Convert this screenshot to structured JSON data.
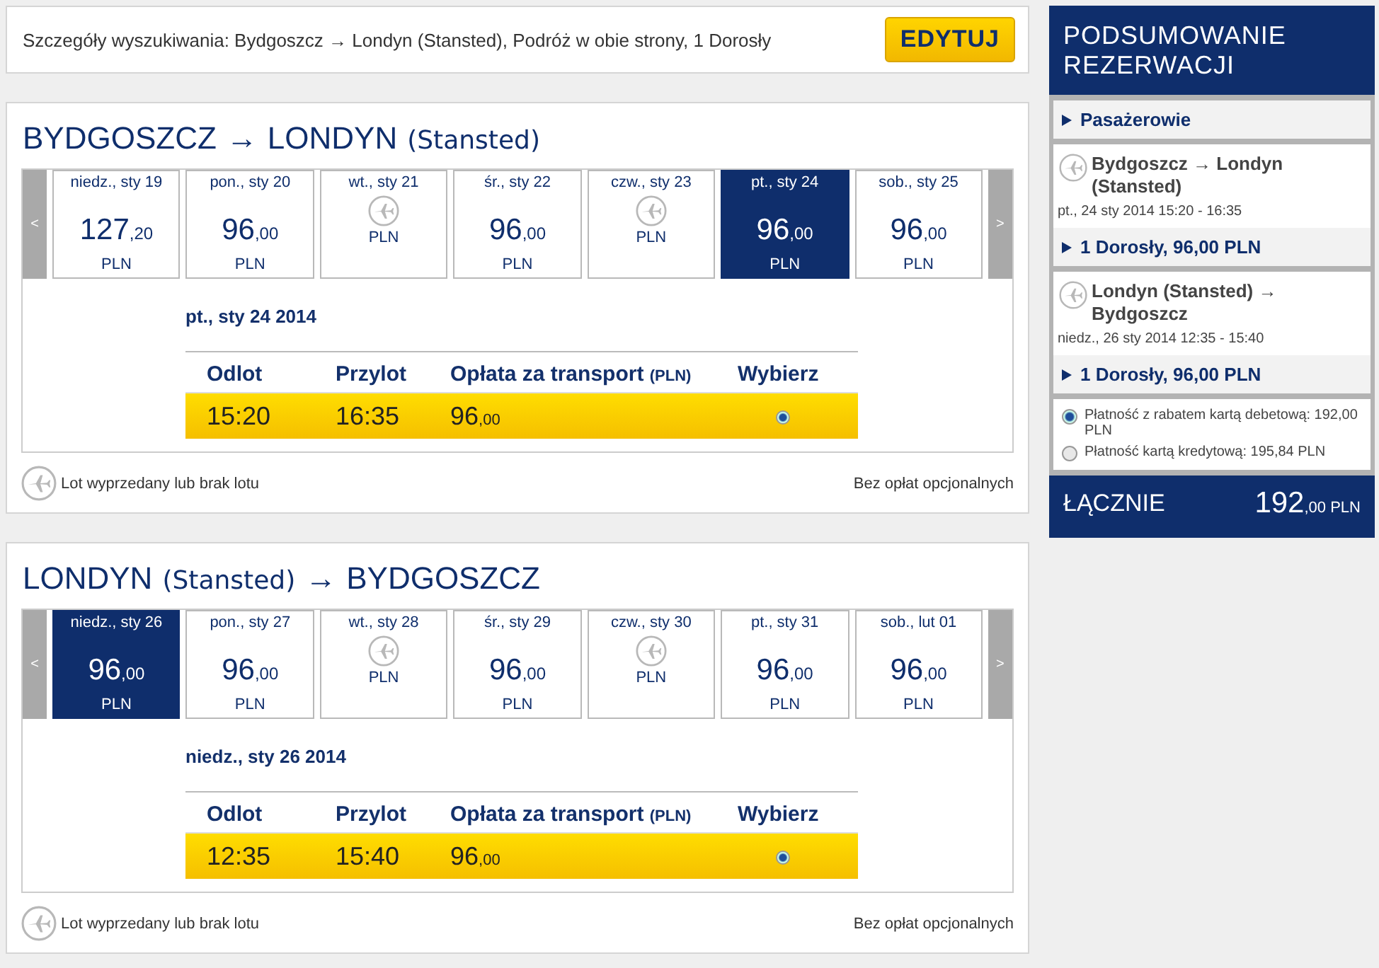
{
  "search": {
    "summary": "Szczegóły wyszukiwania: Bydgoszcz → Londyn (Stansted), Podróż w obie strony, 1 Dorosły",
    "edit_button": "EDYTUJ"
  },
  "flights": [
    {
      "title_parts": [
        {
          "kind": "city",
          "text": "BYDGOSZCZ"
        },
        {
          "kind": "arrow",
          "text": "→"
        },
        {
          "kind": "city",
          "text": "LONDYN"
        },
        {
          "kind": "airport",
          "text": "(Stansted)"
        }
      ],
      "prev": "<",
      "next": ">",
      "days": [
        {
          "label": "niedz., sty 19",
          "kind": "fare",
          "price": "127",
          "cents": ",20",
          "currency": "PLN",
          "selected": false
        },
        {
          "label": "pon., sty 20",
          "kind": "fare",
          "price": "96",
          "cents": ",00",
          "currency": "PLN",
          "selected": false
        },
        {
          "label": "wt., sty 21",
          "kind": "sold_out",
          "currency": "PLN",
          "selected": false
        },
        {
          "label": "śr., sty 22",
          "kind": "fare",
          "price": "96",
          "cents": ",00",
          "currency": "PLN",
          "selected": false
        },
        {
          "label": "czw., sty 23",
          "kind": "sold_out",
          "currency": "PLN",
          "selected": false
        },
        {
          "label": "pt., sty 24",
          "kind": "fare",
          "price": "96",
          "cents": ",00",
          "currency": "PLN",
          "selected": true
        },
        {
          "label": "sob., sty 25",
          "kind": "fare",
          "price": "96",
          "cents": ",00",
          "currency": "PLN",
          "selected": false
        }
      ],
      "detail_date": "pt., sty 24 2014",
      "columns": [
        "Odlot",
        "Przylot",
        "Opłata za transport",
        "Wybierz"
      ],
      "fare_unit": "(PLN)",
      "row": {
        "departure": "15:20",
        "arrival": "16:35",
        "fare": "96",
        "cents": ",00",
        "selected": true
      },
      "legend": "Lot wyprzedany lub brak lotu",
      "note": "Bez opłat opcjonalnych"
    },
    {
      "title_parts": [
        {
          "kind": "city",
          "text": "LONDYN"
        },
        {
          "kind": "airport",
          "text": "(Stansted)"
        },
        {
          "kind": "arrow",
          "text": "→"
        },
        {
          "kind": "city",
          "text": "BYDGOSZCZ"
        }
      ],
      "prev": "<",
      "next": ">",
      "days": [
        {
          "label": "niedz., sty 26",
          "kind": "fare",
          "price": "96",
          "cents": ",00",
          "currency": "PLN",
          "selected": true
        },
        {
          "label": "pon., sty 27",
          "kind": "fare",
          "price": "96",
          "cents": ",00",
          "currency": "PLN",
          "selected": false
        },
        {
          "label": "wt., sty 28",
          "kind": "sold_out",
          "currency": "PLN",
          "selected": false
        },
        {
          "label": "śr., sty 29",
          "kind": "fare",
          "price": "96",
          "cents": ",00",
          "currency": "PLN",
          "selected": false
        },
        {
          "label": "czw., sty 30",
          "kind": "sold_out",
          "currency": "PLN",
          "selected": false
        },
        {
          "label": "pt., sty 31",
          "kind": "fare",
          "price": "96",
          "cents": ",00",
          "currency": "PLN",
          "selected": false
        },
        {
          "label": "sob., lut 01",
          "kind": "fare",
          "price": "96",
          "cents": ",00",
          "currency": "PLN",
          "selected": false
        }
      ],
      "detail_date": "niedz., sty 26 2014",
      "columns": [
        "Odlot",
        "Przylot",
        "Opłata za transport",
        "Wybierz"
      ],
      "fare_unit": "(PLN)",
      "row": {
        "departure": "12:35",
        "arrival": "15:40",
        "fare": "96",
        "cents": ",00",
        "selected": true
      },
      "legend": "Lot wyprzedany lub brak lotu",
      "note": "Bez opłat opcjonalnych"
    }
  ],
  "summary": {
    "title": "PODSUMOWANIE REZERWACJI",
    "passengers": "Pasażerowie",
    "legs": [
      {
        "route": "Bydgoszcz → Londyn (Stansted)",
        "time": "pt., 24 sty 2014 15:20 - 16:35",
        "fare": "1 Dorosły, 96,00 PLN"
      },
      {
        "route": "Londyn (Stansted) → Bydgoszcz",
        "time": "niedz., 26 sty 2014 12:35 - 15:40",
        "fare": "1 Dorosły, 96,00 PLN"
      }
    ],
    "payments": [
      {
        "label": "Płatność z rabatem kartą debetową: 192,00 PLN",
        "selected": true
      },
      {
        "label": "Płatność kartą kredytową: 195,84 PLN",
        "selected": false
      }
    ],
    "total_label": "ŁĄCZNIE",
    "total": "192",
    "total_cents": ",00",
    "total_currency": "PLN"
  }
}
